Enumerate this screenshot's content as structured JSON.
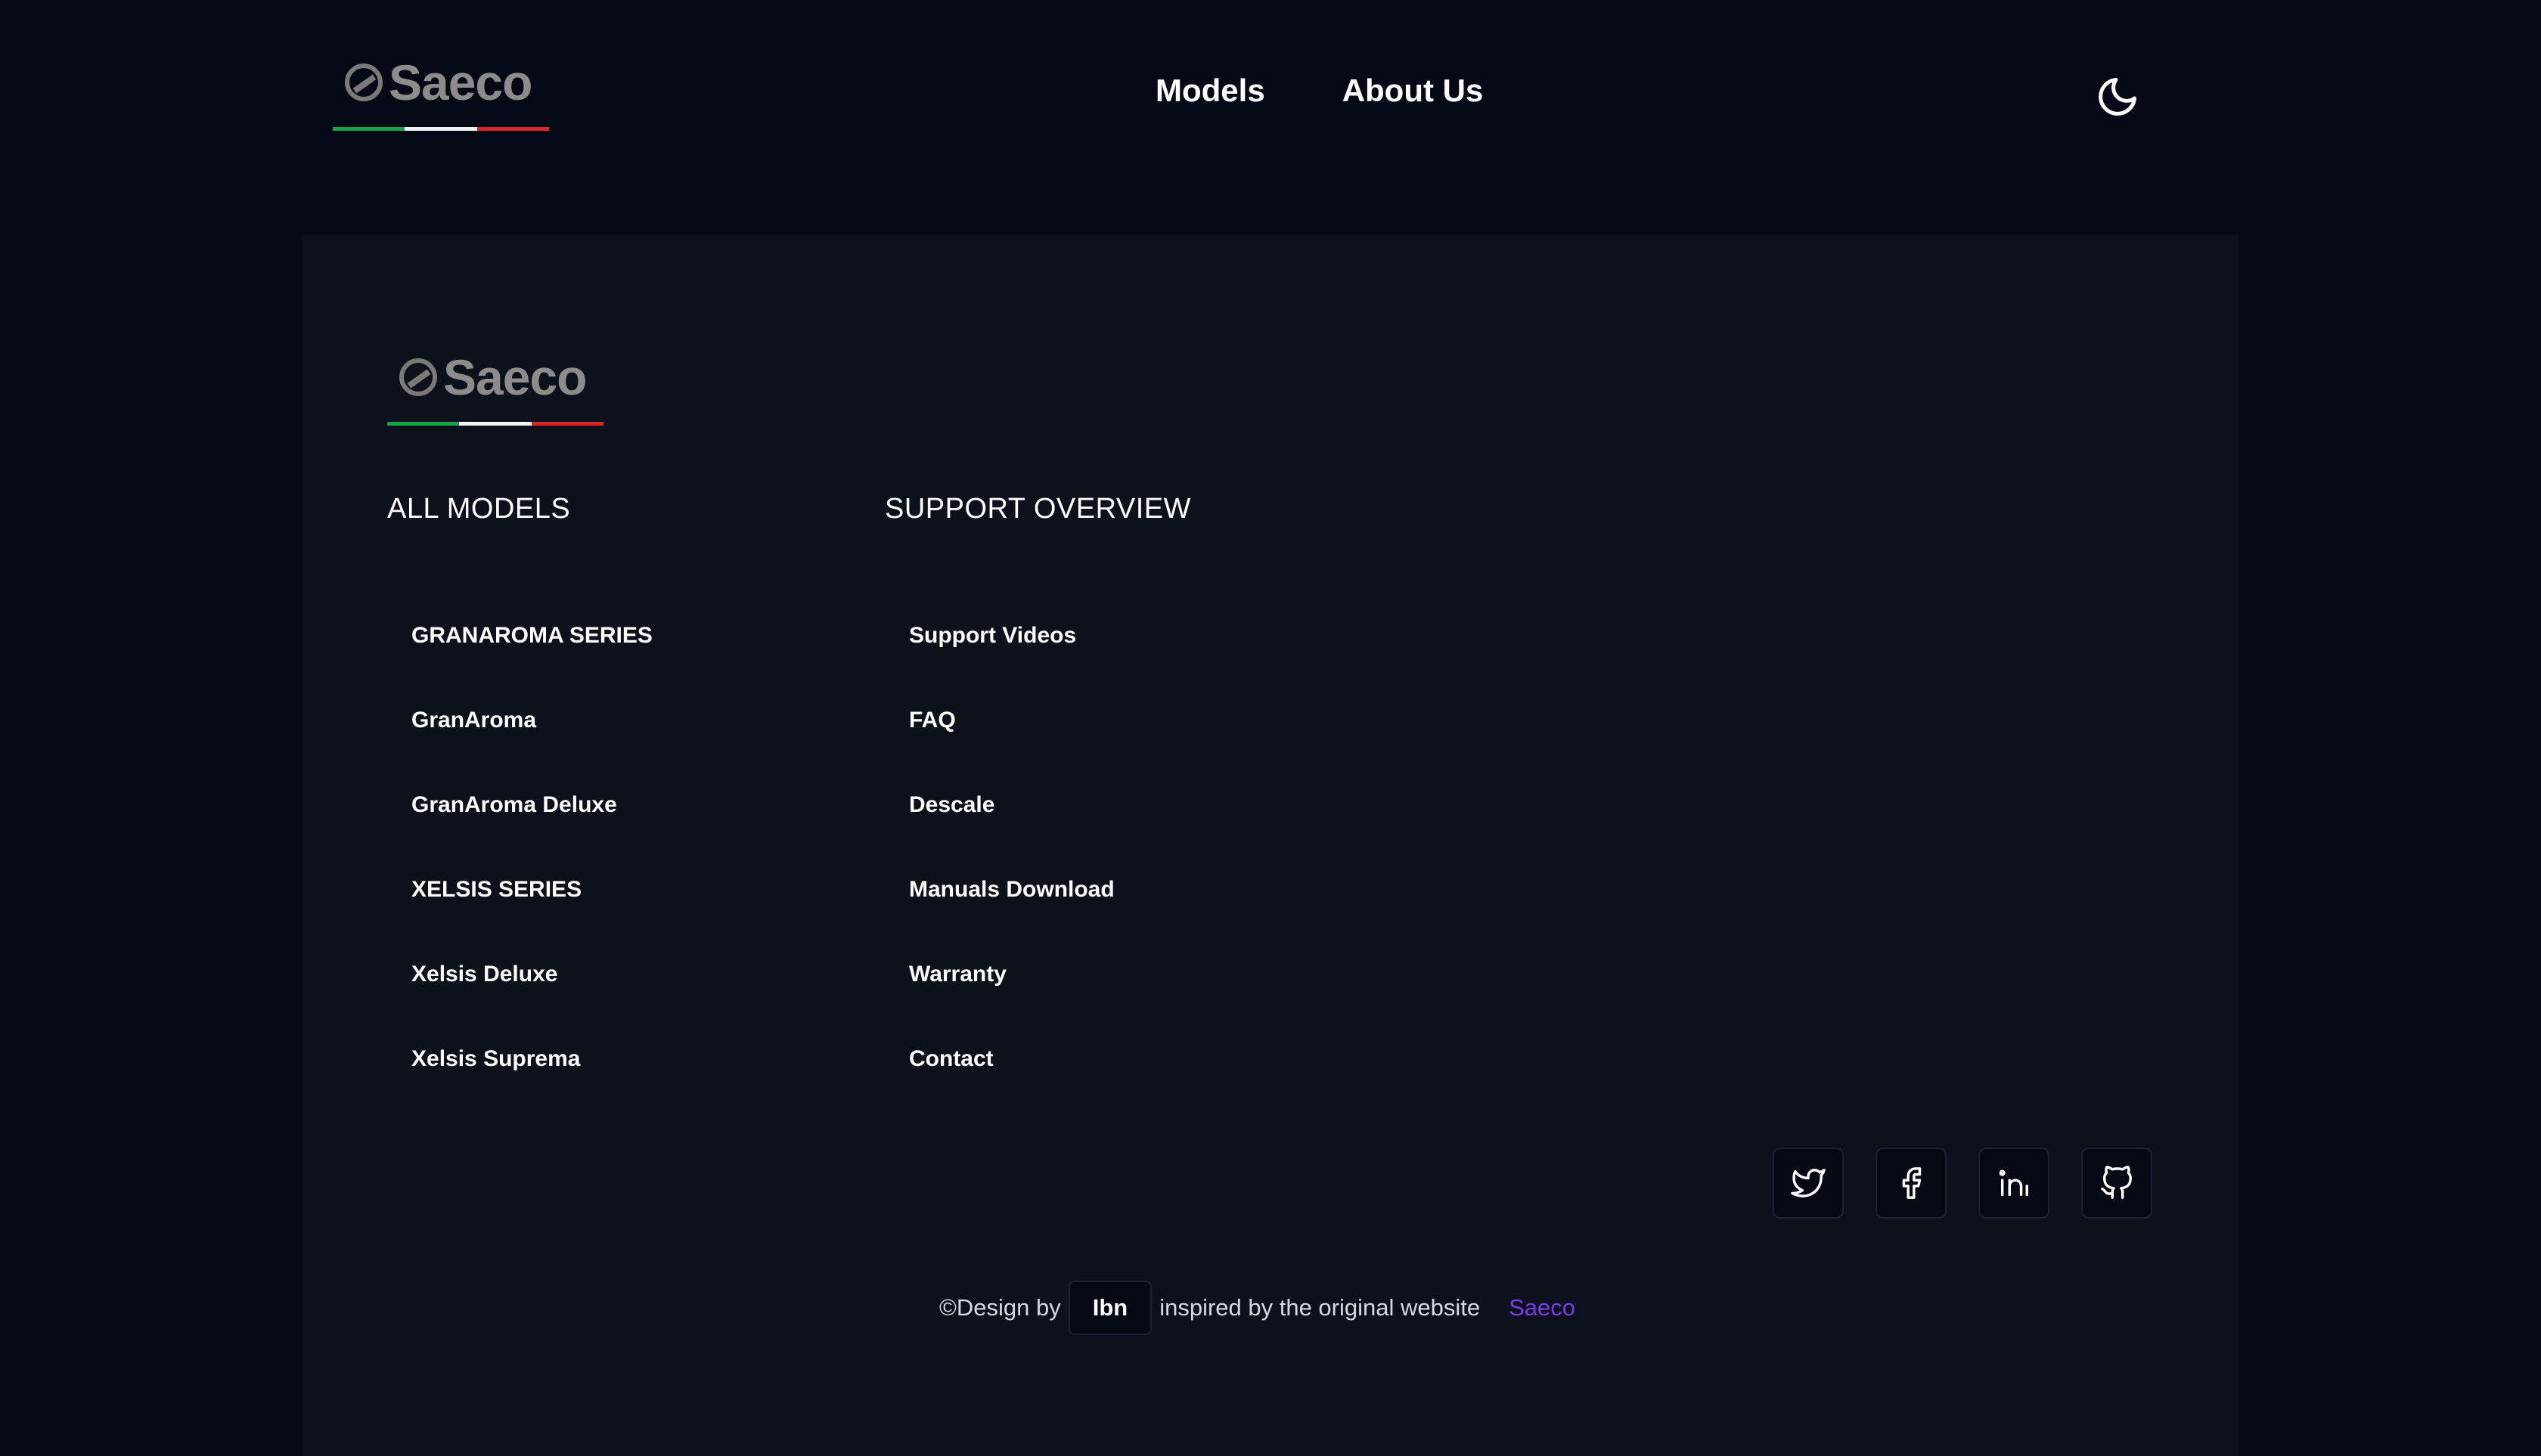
{
  "header": {
    "logo_text": "Saeco",
    "nav": [
      {
        "label": "Models"
      },
      {
        "label": "About Us"
      }
    ],
    "theme_toggle_icon": "moon-icon"
  },
  "footer": {
    "logo_text": "Saeco",
    "columns": [
      {
        "title": "ALL MODELS",
        "items": [
          "GRANAROMA SERIES",
          "GranAroma",
          "GranAroma Deluxe",
          "XELSIS SERIES",
          "Xelsis Deluxe",
          "Xelsis Suprema"
        ]
      },
      {
        "title": "SUPPORT OVERVIEW",
        "items": [
          "Support Videos",
          "FAQ",
          "Descale",
          "Manuals Download",
          "Warranty",
          "Contact"
        ]
      }
    ],
    "social": [
      "twitter-icon",
      "facebook-icon",
      "linkedin-icon",
      "github-icon"
    ],
    "credit": {
      "prefix": "©Design by",
      "author": "Ibn",
      "middle": "inspired by the original website",
      "link": "Saeco"
    }
  },
  "colors": {
    "page_bg": "#050915",
    "footer_bg": "#0c111c",
    "accent_link": "#7c3aed",
    "underline_green": "#16a34a",
    "underline_white": "#f1f1f1",
    "underline_red": "#dc2626"
  }
}
